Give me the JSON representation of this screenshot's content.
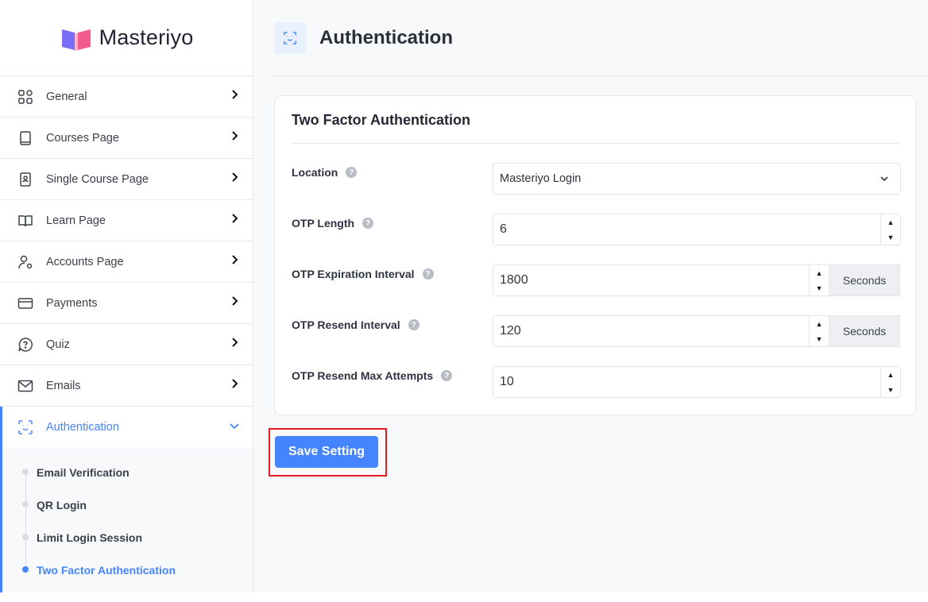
{
  "brand": {
    "name": "Masteriyo"
  },
  "sidebar": {
    "items": [
      {
        "label": "General",
        "icon": "grid-icon"
      },
      {
        "label": "Courses Page",
        "icon": "book-icon"
      },
      {
        "label": "Single Course Page",
        "icon": "contact-book-icon"
      },
      {
        "label": "Learn Page",
        "icon": "open-book-icon"
      },
      {
        "label": "Accounts Page",
        "icon": "user-settings-icon"
      },
      {
        "label": "Payments",
        "icon": "credit-card-icon"
      },
      {
        "label": "Quiz",
        "icon": "question-chat-icon"
      },
      {
        "label": "Emails",
        "icon": "mail-icon"
      },
      {
        "label": "Authentication",
        "icon": "face-scan-icon",
        "active": true
      }
    ],
    "submenu": [
      {
        "label": "Email Verification"
      },
      {
        "label": "QR Login"
      },
      {
        "label": "Limit Login Session"
      },
      {
        "label": "Two Factor Authentication",
        "active": true
      }
    ]
  },
  "header": {
    "title": "Authentication",
    "icon": "face-scan-icon"
  },
  "card": {
    "title": "Two Factor Authentication",
    "fields": {
      "location": {
        "label": "Location",
        "value": "Masteriyo Login"
      },
      "otp_length": {
        "label": "OTP Length",
        "value": "6"
      },
      "otp_expiration": {
        "label": "OTP Expiration Interval",
        "value": "1800",
        "unit": "Seconds"
      },
      "otp_resend": {
        "label": "OTP Resend Interval",
        "value": "120",
        "unit": "Seconds"
      },
      "otp_max_attempts": {
        "label": "OTP Resend Max Attempts",
        "value": "10"
      }
    },
    "help_glyph": "?"
  },
  "actions": {
    "save_label": "Save Setting"
  },
  "colors": {
    "accent": "#4584ff",
    "highlight_border": "#e51b20"
  }
}
